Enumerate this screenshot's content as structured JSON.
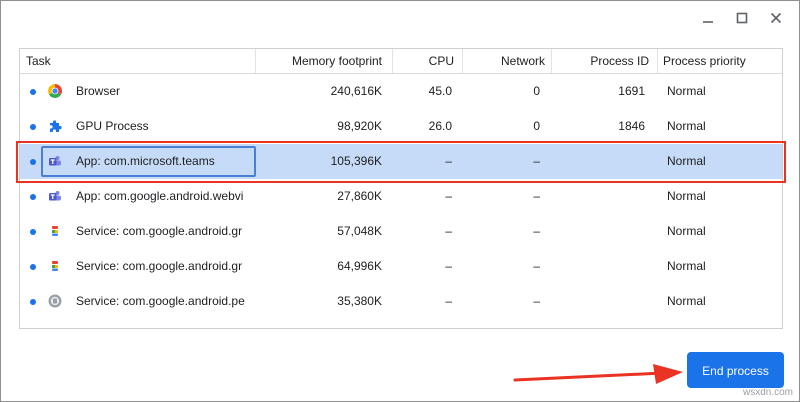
{
  "window": {
    "controls": [
      {
        "icon": "minimize-icon"
      },
      {
        "icon": "maximize-icon"
      },
      {
        "icon": "close-icon"
      }
    ]
  },
  "table": {
    "columns": [
      "Task",
      "Memory footprint",
      "CPU",
      "Network",
      "Process ID",
      "Process priority"
    ],
    "rows": [
      {
        "icon": "chrome-icon",
        "task": "Browser",
        "memory": "240,616K",
        "cpu": "45.0",
        "network": "0",
        "pid": "1691",
        "priority": "Normal",
        "selected": false
      },
      {
        "icon": "puzzle-icon",
        "task": "GPU Process",
        "memory": "98,920K",
        "cpu": "26.0",
        "network": "0",
        "pid": "1846",
        "priority": "Normal",
        "selected": false
      },
      {
        "icon": "teams-icon",
        "task": "App: com.microsoft.teams",
        "memory": "105,396K",
        "cpu": "–",
        "network": "–",
        "pid": "",
        "priority": "Normal",
        "selected": true
      },
      {
        "icon": "teams-icon",
        "task": "App: com.google.android.webvi",
        "memory": "27,860K",
        "cpu": "–",
        "network": "–",
        "pid": "",
        "priority": "Normal",
        "selected": false
      },
      {
        "icon": "android-service-icon",
        "task": "Service: com.google.android.gr",
        "memory": "57,048K",
        "cpu": "–",
        "network": "–",
        "pid": "",
        "priority": "Normal",
        "selected": false
      },
      {
        "icon": "android-service-icon",
        "task": "Service: com.google.android.gr",
        "memory": "64,996K",
        "cpu": "–",
        "network": "–",
        "pid": "",
        "priority": "Normal",
        "selected": false
      },
      {
        "icon": "gear-service-icon",
        "task": "Service: com.google.android.pe",
        "memory": "35,380K",
        "cpu": "–",
        "network": "–",
        "pid": "",
        "priority": "Normal",
        "selected": false
      }
    ]
  },
  "actions": {
    "end_process": "End process"
  },
  "watermark": "wsxdn.com",
  "colors": {
    "accent": "#1a73e8",
    "selection": "#c6dbf7",
    "highlight_annotation": "#ea3323"
  }
}
